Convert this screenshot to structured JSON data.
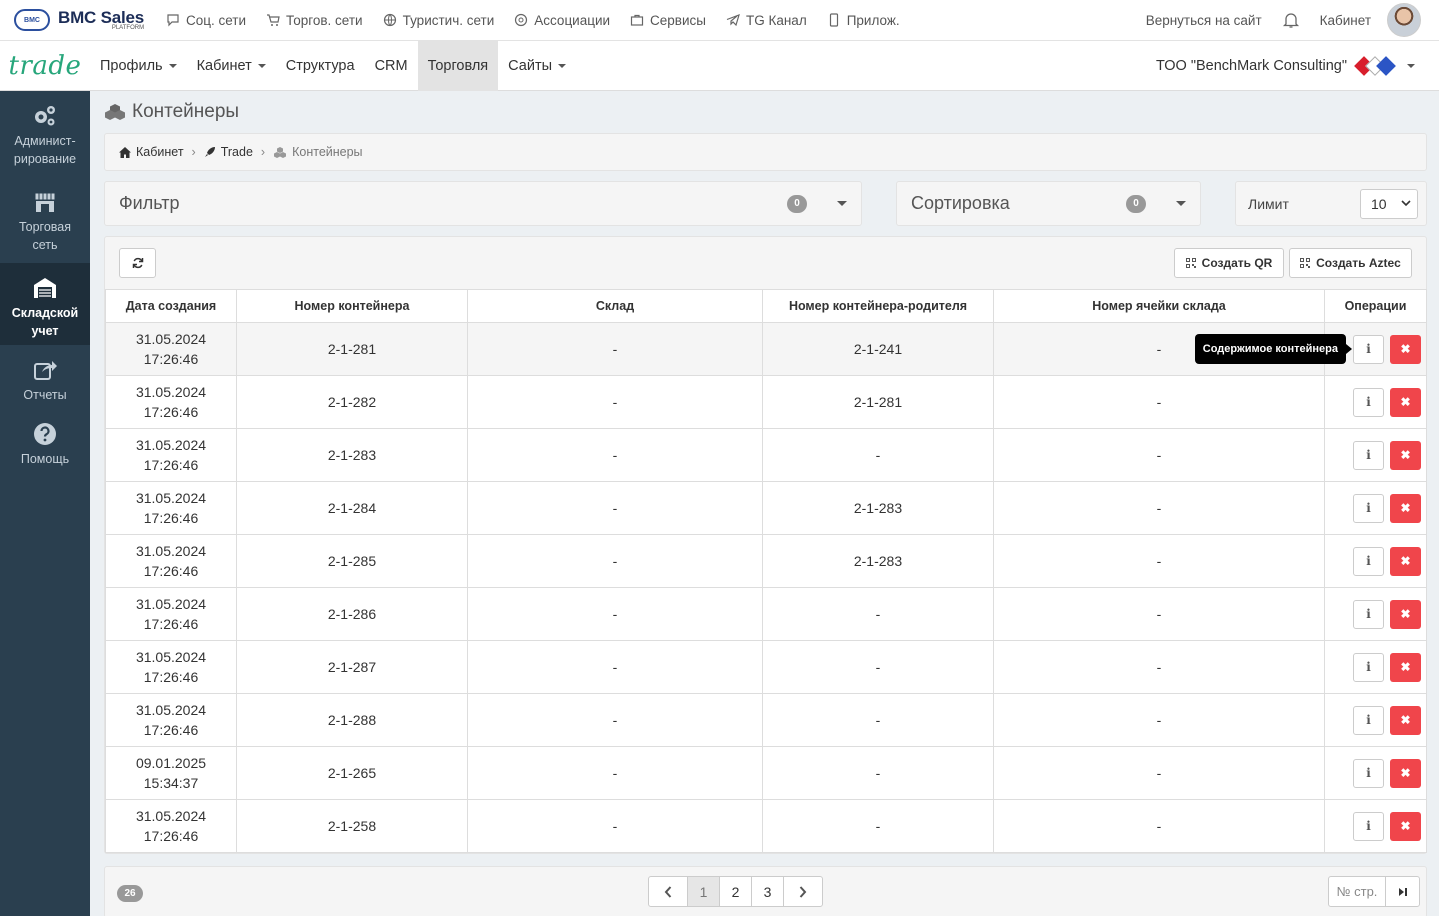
{
  "brand": {
    "name": "BMC Sales",
    "sub": "PLATFORM",
    "logo_text": "BMC"
  },
  "topnav": [
    {
      "label": "Соц. сети",
      "icon": "chat-icon"
    },
    {
      "label": "Торгов. сети",
      "icon": "cart-icon"
    },
    {
      "label": "Туристич. сети",
      "icon": "globe-icon"
    },
    {
      "label": "Ассоциации",
      "icon": "network-icon"
    },
    {
      "label": "Сервисы",
      "icon": "briefcase-icon"
    },
    {
      "label": "TG Канал",
      "icon": "telegram-icon"
    },
    {
      "label": "Прилож.",
      "icon": "phone-icon"
    }
  ],
  "top_right": {
    "back_label": "Вернуться на сайт",
    "cabinet_label": "Кабинет"
  },
  "logo_trade": "trade",
  "mainnav": [
    {
      "label": "Профиль",
      "dropdown": true
    },
    {
      "label": "Кабинет",
      "dropdown": true
    },
    {
      "label": "Структура",
      "dropdown": false
    },
    {
      "label": "CRM",
      "dropdown": false
    },
    {
      "label": "Торговля",
      "dropdown": false,
      "active": true
    },
    {
      "label": "Сайты",
      "dropdown": true
    }
  ],
  "company": {
    "name": "ТОО \"BenchMark Consulting\"",
    "logo_letters": [
      "B",
      "M",
      "C"
    ]
  },
  "sidebar": [
    {
      "label": "Админист-рирование",
      "icon": "gears-icon"
    },
    {
      "label": "Торговая сеть",
      "icon": "store-icon"
    },
    {
      "label": "Складской учет",
      "icon": "warehouse-icon",
      "active": true
    },
    {
      "label": "Отчеты",
      "icon": "share-icon"
    },
    {
      "label": "Помощь",
      "icon": "help-icon"
    }
  ],
  "page": {
    "title": "Контейнеры"
  },
  "breadcrumb": [
    "Кабинет",
    "Trade",
    "Контейнеры"
  ],
  "filter": {
    "title": "Фильтр",
    "count": "0"
  },
  "sort": {
    "title": "Сортировка",
    "count": "0"
  },
  "limit": {
    "label": "Лимит",
    "value": "10"
  },
  "toolbar": {
    "qr_label": "Создать QR",
    "aztec_label": "Создать Aztec"
  },
  "table": {
    "headers": [
      "Дата создания",
      "Номер контейнера",
      "Склад",
      "Номер контейнера-родителя",
      "Номер ячейки склада",
      "Операции"
    ],
    "rows": [
      {
        "date": "31.05.2024",
        "time": "17:26:46",
        "number": "2-1-281",
        "warehouse": "-",
        "parent": "2-1-241",
        "cell": "-"
      },
      {
        "date": "31.05.2024",
        "time": "17:26:46",
        "number": "2-1-282",
        "warehouse": "-",
        "parent": "2-1-281",
        "cell": "-"
      },
      {
        "date": "31.05.2024",
        "time": "17:26:46",
        "number": "2-1-283",
        "warehouse": "-",
        "parent": "-",
        "cell": "-"
      },
      {
        "date": "31.05.2024",
        "time": "17:26:46",
        "number": "2-1-284",
        "warehouse": "-",
        "parent": "2-1-283",
        "cell": "-"
      },
      {
        "date": "31.05.2024",
        "time": "17:26:46",
        "number": "2-1-285",
        "warehouse": "-",
        "parent": "2-1-283",
        "cell": "-"
      },
      {
        "date": "31.05.2024",
        "time": "17:26:46",
        "number": "2-1-286",
        "warehouse": "-",
        "parent": "-",
        "cell": "-"
      },
      {
        "date": "31.05.2024",
        "time": "17:26:46",
        "number": "2-1-287",
        "warehouse": "-",
        "parent": "-",
        "cell": "-"
      },
      {
        "date": "31.05.2024",
        "time": "17:26:46",
        "number": "2-1-288",
        "warehouse": "-",
        "parent": "-",
        "cell": "-"
      },
      {
        "date": "09.01.2025",
        "time": "15:34:37",
        "number": "2-1-265",
        "warehouse": "-",
        "parent": "-",
        "cell": "-"
      },
      {
        "date": "31.05.2024",
        "time": "17:26:46",
        "number": "2-1-258",
        "warehouse": "-",
        "parent": "-",
        "cell": "-"
      }
    ],
    "tooltip": "Содержимое контейнера",
    "info_glyph": "i",
    "delete_glyph": "✖"
  },
  "pager": {
    "total": "26",
    "pages": [
      "1",
      "2",
      "3"
    ],
    "current": "1",
    "page_num_label": "№ стр."
  },
  "colors": {
    "accent_green": "#27a67b",
    "sidebar": "#2a3f4f",
    "delete_red": "#f0454b"
  }
}
